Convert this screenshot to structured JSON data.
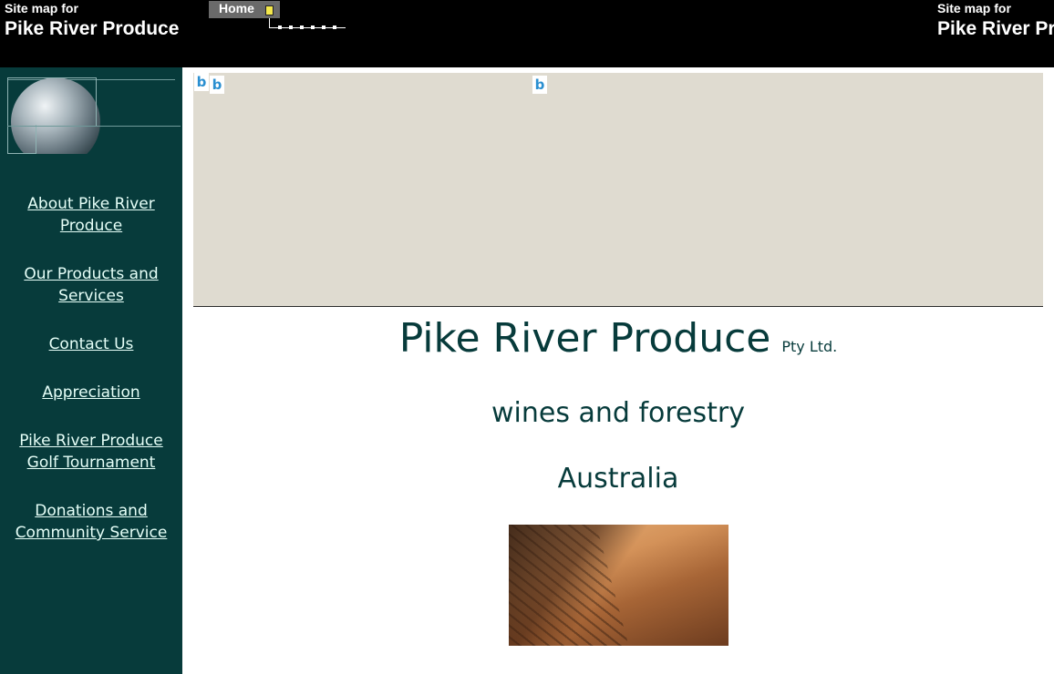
{
  "header": {
    "site_map_small": "Site map for",
    "site_map_big": "Pike River Produce",
    "right_site_map_small": "Site map for",
    "right_site_map_big": "Pike River Pr",
    "home_tab": "Home"
  },
  "sidebar": {
    "items": [
      {
        "label_line1": "About Pike River",
        "label_line2": "Produce"
      },
      {
        "label_line1": "Our Products and",
        "label_line2": "Services"
      },
      {
        "label_line1": "Contact Us",
        "label_line2": ""
      },
      {
        "label_line1": "Appreciation",
        "label_line2": ""
      },
      {
        "label_line1": "Pike River Produce",
        "label_line2": "Golf Tournament"
      },
      {
        "label_line1": "Donations and",
        "label_line2": "Community Service"
      }
    ]
  },
  "main": {
    "title": "Pike River Produce",
    "title_suffix": "Pty Ltd.",
    "tagline": "wines and forestry",
    "country": "Australia"
  },
  "icons": {
    "banner_placeholder": "broken-image-icon",
    "sidebar_logo": "globe-icon",
    "home_marker": "current-page-marker-icon"
  },
  "colors": {
    "sidebar_bg": "#073b3b",
    "link_color": "#e6fff8",
    "title_color": "#073b3b",
    "banner_bg": "#dfdbd0",
    "topbar_bg": "#000000"
  }
}
